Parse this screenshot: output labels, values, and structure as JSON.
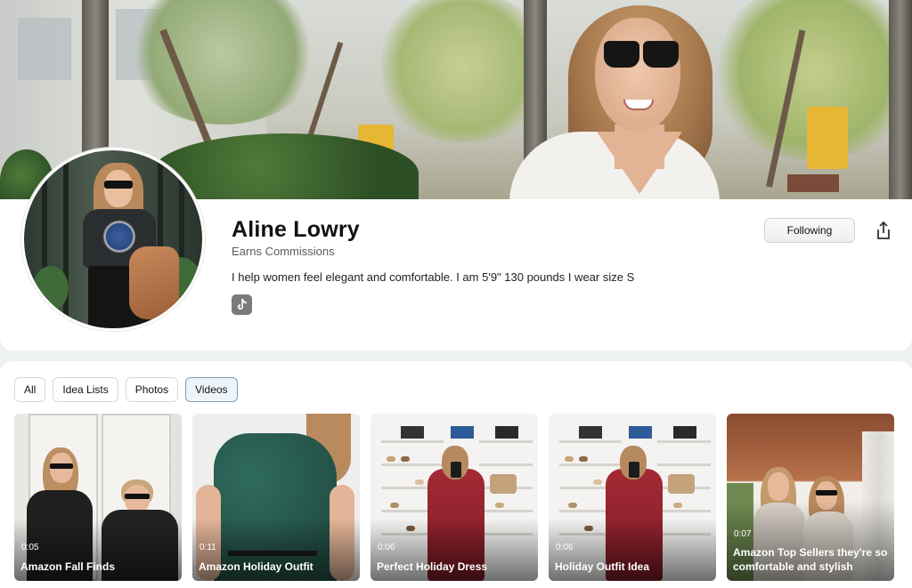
{
  "profile": {
    "name": "Aline Lowry",
    "commission": "Earns Commissions",
    "bio": "I help women feel elegant and comfortable. I am 5'9\" 130 pounds I wear size S",
    "following_label": "Following"
  },
  "icons": {
    "social": "tiktok-icon",
    "share": "share-icon"
  },
  "filters": [
    "All",
    "Idea Lists",
    "Photos",
    "Videos"
  ],
  "active_filter": "Videos",
  "videos": [
    {
      "duration": "0:05",
      "title": "Amazon Fall Finds"
    },
    {
      "duration": "0:11",
      "title": "Amazon Holiday Outfit"
    },
    {
      "duration": "0:06",
      "title": "Perfect Holiday Dress"
    },
    {
      "duration": "0:06",
      "title": "Holiday Outfit Idea"
    },
    {
      "duration": "0:07",
      "title": "Amazon Top Sellers they're so comfortable and stylish"
    }
  ],
  "colors": {
    "active_chip_bg": "#edf5fa",
    "active_chip_border": "#7e9fb8",
    "page_bg": "#eef1f1"
  }
}
